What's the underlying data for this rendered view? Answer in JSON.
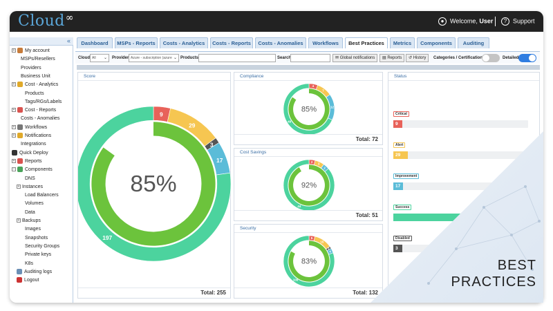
{
  "header": {
    "logo_text": "Cloud",
    "logo_symbol": "∞",
    "welcome_prefix": "Welcome, ",
    "user_name": "User",
    "support_label": "Support",
    "user_icon": "user-circle-icon",
    "help_icon": "question-circle-icon"
  },
  "sidebar": {
    "collapse_label": "«",
    "items": [
      {
        "label": "My account"
      },
      {
        "label": "MSPs/Resellers"
      },
      {
        "label": "Providers"
      },
      {
        "label": "Business Unit"
      },
      {
        "label": "Cost - Analytics"
      },
      {
        "label": "Products"
      },
      {
        "label": "Tags/RGs/Labels"
      },
      {
        "label": "Cost - Reports"
      },
      {
        "label": "Costs - Anomalies"
      },
      {
        "label": "Workflows"
      },
      {
        "label": "Notifications"
      },
      {
        "label": "Integrations"
      },
      {
        "label": "Quick Deploy"
      },
      {
        "label": "Reports"
      },
      {
        "label": "Components"
      },
      {
        "label": "DNS"
      },
      {
        "label": "Instances"
      },
      {
        "label": "Load Balancers"
      },
      {
        "label": "Volumes"
      },
      {
        "label": "Data"
      },
      {
        "label": "Backups"
      },
      {
        "label": "Images"
      },
      {
        "label": "Snapshots"
      },
      {
        "label": "Security Groups"
      },
      {
        "label": "Private keys"
      },
      {
        "label": "K8s"
      },
      {
        "label": "Auditing logs"
      },
      {
        "label": "Logout"
      }
    ]
  },
  "tabs": [
    {
      "label": "Dashboard"
    },
    {
      "label": "MSPs - Reports"
    },
    {
      "label": "Costs - Analytics"
    },
    {
      "label": "Costs - Reports"
    },
    {
      "label": "Costs - Anomalies"
    },
    {
      "label": "Workflows"
    },
    {
      "label": "Best Practices"
    },
    {
      "label": "Metrics"
    },
    {
      "label": "Components"
    },
    {
      "label": "Auditing"
    }
  ],
  "active_tab": "Best Practices",
  "filters": {
    "cloud_label": "Cloud",
    "cloud_value": "All",
    "provider_label": "Provider",
    "provider_value": "Azure - subscription (azure",
    "products_label": "Products",
    "products_value": "",
    "search_label": "Search",
    "search_value": "",
    "global_notifications_label": "Global notifications",
    "reports_label": "Reports",
    "history_label": "History",
    "categories_label": "Categories / Certifications",
    "categories_on": false,
    "detailed_label": "Detailed",
    "detailed_on": true
  },
  "panels": {
    "score": {
      "title": "Score",
      "center": "85%",
      "total_label": "Total: 255",
      "outer": [
        {
          "name": "critical",
          "value": 9,
          "color": "#e8625a"
        },
        {
          "name": "alert",
          "value": 29,
          "color": "#f6c651"
        },
        {
          "name": "disabled",
          "value": 3,
          "color": "#555555"
        },
        {
          "name": "improvement",
          "value": 17,
          "color": "#5bbcd8"
        },
        {
          "name": "success",
          "value": 197,
          "color": "#4cd39e"
        }
      ],
      "inner_fraction": 0.85
    },
    "compliance": {
      "title": "Compliance",
      "center": "85%",
      "total_label": "Total: 72",
      "outer": [
        {
          "name": "critical",
          "value": 4,
          "color": "#e8625a"
        },
        {
          "name": "alert",
          "value": 7,
          "color": "#f6c651"
        },
        {
          "name": "improvement",
          "value": 12,
          "color": "#5bbcd8"
        },
        {
          "name": "success",
          "value": 49,
          "color": "#4cd39e"
        }
      ],
      "inner_fraction": 0.85
    },
    "cost_savings": {
      "title": "Cost Savings",
      "center": "92%",
      "total_label": "Total: 51",
      "outer": [
        {
          "name": "critical",
          "value": 2,
          "color": "#e8625a"
        },
        {
          "name": "alert",
          "value": 3,
          "color": "#f6c651"
        },
        {
          "name": "improvement",
          "value": 2,
          "color": "#5bbcd8"
        },
        {
          "name": "success",
          "value": 44,
          "color": "#4cd39e"
        }
      ],
      "inner_fraction": 0.92
    },
    "security": {
      "title": "Security",
      "center": "83%",
      "total_label": "Total: 132",
      "outer": [
        {
          "name": "critical",
          "value": 5,
          "color": "#e8625a"
        },
        {
          "name": "alert",
          "value": 15,
          "color": "#f6c651"
        },
        {
          "name": "disabled",
          "value": 2,
          "color": "#555555"
        },
        {
          "name": "improvement",
          "value": 4,
          "color": "#5bbcd8"
        },
        {
          "name": "success",
          "value": 106,
          "color": "#4cd39e"
        }
      ],
      "inner_fraction": 0.83
    },
    "status": {
      "title": "Status",
      "rows": [
        {
          "label": "Critical",
          "value": 9,
          "color": "#e8625a",
          "fraction": 0.04
        },
        {
          "label": "Alert",
          "value": 29,
          "color": "#f6c651",
          "fraction": 0.11
        },
        {
          "label": "Improvement",
          "value": 17,
          "color": "#5bbcd8",
          "fraction": 0.07
        },
        {
          "label": "Success",
          "value": 197,
          "color": "#4cd39e",
          "fraction": 0.77
        },
        {
          "label": "Disabled",
          "value": 3,
          "color": "#555555",
          "fraction": 0.04
        }
      ]
    }
  },
  "overlay": {
    "line1": "BEST",
    "line2": "PRACTICES"
  },
  "colors": {
    "inner_ring": "#6cc33c",
    "accent": "#2b5f95"
  }
}
